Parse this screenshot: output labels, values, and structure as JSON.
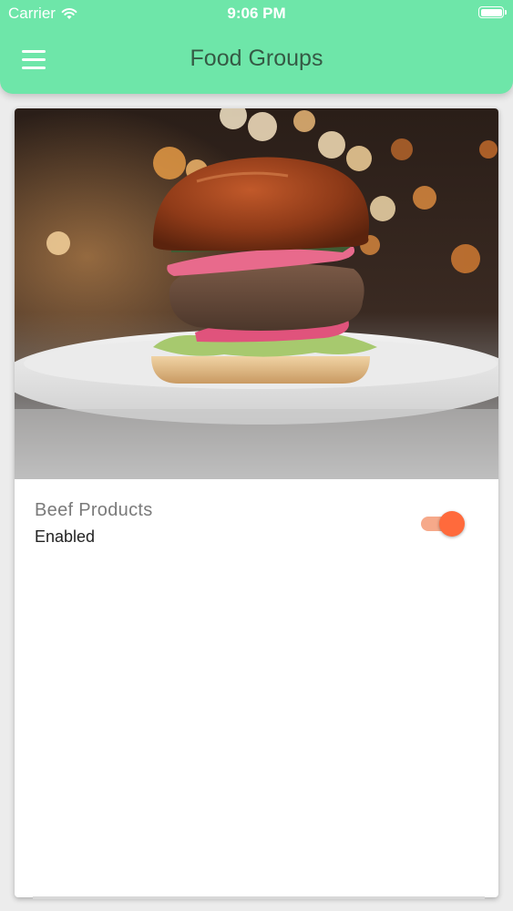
{
  "status_bar": {
    "carrier": "Carrier",
    "time": "9:06 PM",
    "wifi_icon": "wifi-icon",
    "battery_icon": "battery-icon"
  },
  "header": {
    "title": "Food Groups",
    "menu_icon": "hamburger-menu-icon",
    "background_color": "#6ee6a9",
    "title_color": "#355a45"
  },
  "card": {
    "image": "burger-photo",
    "title": "Beef Products",
    "status": "Enabled",
    "toggle_on": true,
    "toggle_color": "#ff6a3c"
  }
}
